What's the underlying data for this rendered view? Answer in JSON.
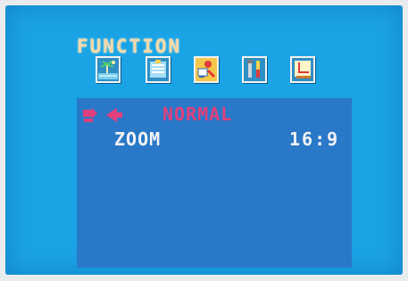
{
  "menu": {
    "title": "FUNCTION",
    "icons": [
      {
        "name": "picture-icon",
        "selected": false
      },
      {
        "name": "color-icon",
        "selected": false
      },
      {
        "name": "function-icon",
        "selected": true
      },
      {
        "name": "tools-icon",
        "selected": false
      },
      {
        "name": "osd-icon",
        "selected": false
      }
    ]
  },
  "panel": {
    "mode_label": "NORMAL",
    "item_label": "ZOOM",
    "item_value": "16:9"
  },
  "colors": {
    "screen_bg": "#1aa4e6",
    "panel_bg": "#2a78c8",
    "title": "#f5d9a8",
    "highlight": "#e0407c",
    "selected_icon": "#f4c84a"
  }
}
